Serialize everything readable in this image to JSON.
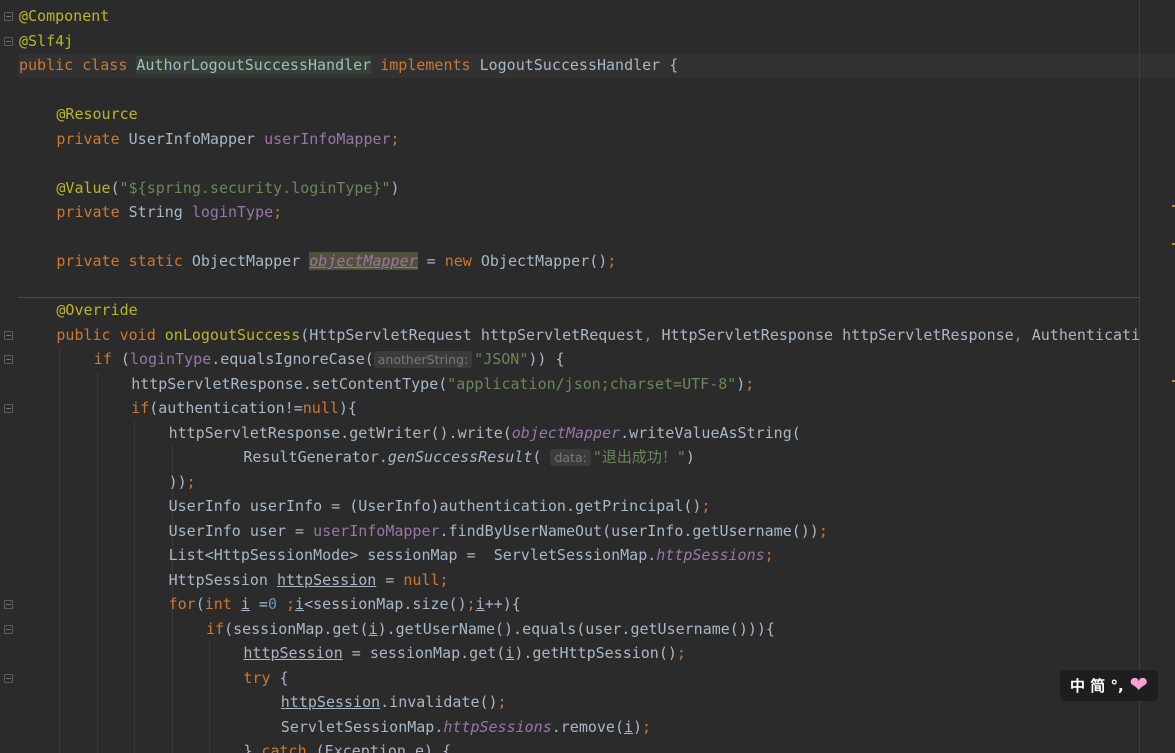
{
  "editor": {
    "language": "java",
    "lines": [
      {
        "indent": 0,
        "fold": true,
        "tokens": [
          {
            "t": "@Component",
            "c": "ann"
          }
        ]
      },
      {
        "indent": 0,
        "fold": true,
        "tokens": [
          {
            "t": "@Slf4j",
            "c": "ann"
          }
        ]
      },
      {
        "indent": 0,
        "fold": false,
        "tokens": [
          {
            "t": "public ",
            "c": "kw"
          },
          {
            "t": "class ",
            "c": "kw"
          },
          {
            "t": "AuthorLogoutSuccessHandler",
            "c": "cls-hl"
          },
          {
            "t": " implements ",
            "c": "kw"
          },
          {
            "t": "LogoutSuccessHandler {",
            "c": ""
          }
        ]
      },
      {
        "indent": 0,
        "fold": false,
        "tokens": []
      },
      {
        "indent": 4,
        "fold": false,
        "tokens": [
          {
            "t": "@Resource",
            "c": "ann"
          }
        ]
      },
      {
        "indent": 4,
        "fold": false,
        "tokens": [
          {
            "t": "private ",
            "c": "kw"
          },
          {
            "t": "UserInfoMapper ",
            "c": ""
          },
          {
            "t": "userInfoMapper",
            "c": "fld"
          },
          {
            "t": ";",
            "c": "kw"
          }
        ]
      },
      {
        "indent": 0,
        "fold": false,
        "tokens": []
      },
      {
        "indent": 4,
        "fold": false,
        "tokens": [
          {
            "t": "@Value",
            "c": "ann"
          },
          {
            "t": "(",
            "c": ""
          },
          {
            "t": "\"${spring.security.loginType}\"",
            "c": "str"
          },
          {
            "t": ")",
            "c": ""
          }
        ]
      },
      {
        "indent": 4,
        "fold": false,
        "tokens": [
          {
            "t": "private ",
            "c": "kw"
          },
          {
            "t": "String ",
            "c": ""
          },
          {
            "t": "loginType",
            "c": "fld"
          },
          {
            "t": ";",
            "c": "kw"
          }
        ]
      },
      {
        "indent": 0,
        "fold": false,
        "tokens": []
      },
      {
        "indent": 4,
        "fold": false,
        "tokens": [
          {
            "t": "private ",
            "c": "kw"
          },
          {
            "t": "static ",
            "c": "kw"
          },
          {
            "t": "ObjectMapper ",
            "c": ""
          },
          {
            "t": "objectMapper",
            "c": "sel"
          },
          {
            "t": " = ",
            "c": ""
          },
          {
            "t": "new ",
            "c": "kw"
          },
          {
            "t": "ObjectMapper()",
            "c": ""
          },
          {
            "t": ";",
            "c": "kw"
          }
        ]
      },
      {
        "indent": 0,
        "fold": false,
        "tokens": []
      },
      {
        "indent": 4,
        "fold": false,
        "tokens": [
          {
            "t": "@Override",
            "c": "ann"
          }
        ]
      },
      {
        "indent": 4,
        "fold": true,
        "tokens": [
          {
            "t": "public ",
            "c": "kw"
          },
          {
            "t": "void ",
            "c": "kw"
          },
          {
            "t": "onLogoutSuccess",
            "c": "ann"
          },
          {
            "t": "(HttpServletRequest httpServletRequest",
            "c": ""
          },
          {
            "t": ", ",
            "c": "kw"
          },
          {
            "t": "HttpServletResponse httpServletResponse",
            "c": ""
          },
          {
            "t": ", ",
            "c": "kw"
          },
          {
            "t": "Authenticati",
            "c": ""
          }
        ]
      },
      {
        "indent": 8,
        "fold": true,
        "tokens": [
          {
            "t": "if ",
            "c": "kw"
          },
          {
            "t": "(",
            "c": ""
          },
          {
            "t": "loginType",
            "c": "fld"
          },
          {
            "t": ".equalsIgnoreCase(",
            "c": ""
          },
          {
            "t": "anotherString:",
            "c": "hint"
          },
          {
            "t": "\"JSON\"",
            "c": "str"
          },
          {
            "t": ")) {",
            "c": ""
          }
        ]
      },
      {
        "indent": 12,
        "fold": false,
        "tokens": [
          {
            "t": "httpServletResponse.setContentType(",
            "c": ""
          },
          {
            "t": "\"application/json;charset=UTF-8\"",
            "c": "str"
          },
          {
            "t": ")",
            "c": ""
          },
          {
            "t": ";",
            "c": "kw"
          }
        ]
      },
      {
        "indent": 12,
        "fold": true,
        "tokens": [
          {
            "t": "if",
            "c": "kw"
          },
          {
            "t": "(authentication!=",
            "c": ""
          },
          {
            "t": "null",
            "c": "kw"
          },
          {
            "t": "){",
            "c": ""
          }
        ]
      },
      {
        "indent": 16,
        "fold": false,
        "tokens": [
          {
            "t": "httpServletResponse.getWriter().write(",
            "c": ""
          },
          {
            "t": "objectMapper",
            "c": "sfld"
          },
          {
            "t": ".writeValueAsString(",
            "c": ""
          }
        ]
      },
      {
        "indent": 24,
        "fold": false,
        "tokens": [
          {
            "t": "ResultGenerator.",
            "c": ""
          },
          {
            "t": "genSuccessResult",
            "c": "smeth"
          },
          {
            "t": "( ",
            "c": ""
          },
          {
            "t": "data:",
            "c": "hint"
          },
          {
            "t": "\"退出成功！\"",
            "c": "str"
          },
          {
            "t": ")",
            "c": ""
          }
        ]
      },
      {
        "indent": 16,
        "fold": false,
        "tokens": [
          {
            "t": "))",
            "c": ""
          },
          {
            "t": ";",
            "c": "kw"
          }
        ]
      },
      {
        "indent": 16,
        "fold": false,
        "tokens": [
          {
            "t": "UserInfo userInfo = (UserInfo)authentication.getPrincipal()",
            "c": ""
          },
          {
            "t": ";",
            "c": "kw"
          }
        ]
      },
      {
        "indent": 16,
        "fold": false,
        "tokens": [
          {
            "t": "UserInfo user = ",
            "c": ""
          },
          {
            "t": "userInfoMapper",
            "c": "fld"
          },
          {
            "t": ".findByUserNameOut(userInfo.getUsername())",
            "c": ""
          },
          {
            "t": ";",
            "c": "kw"
          }
        ]
      },
      {
        "indent": 16,
        "fold": false,
        "tokens": [
          {
            "t": "List<HttpSessionMode> sessionMap =  ServletSessionMap.",
            "c": ""
          },
          {
            "t": "httpSessions",
            "c": "sfld"
          },
          {
            "t": ";",
            "c": "kw"
          }
        ]
      },
      {
        "indent": 16,
        "fold": false,
        "tokens": [
          {
            "t": "HttpSession ",
            "c": ""
          },
          {
            "t": "httpSession",
            "c": "ul"
          },
          {
            "t": " = ",
            "c": ""
          },
          {
            "t": "null",
            "c": "kw"
          },
          {
            "t": ";",
            "c": "kw"
          }
        ]
      },
      {
        "indent": 16,
        "fold": true,
        "tokens": [
          {
            "t": "for",
            "c": "kw"
          },
          {
            "t": "(",
            "c": ""
          },
          {
            "t": "int ",
            "c": "kw"
          },
          {
            "t": "i",
            "c": "ul"
          },
          {
            "t": " =",
            "c": ""
          },
          {
            "t": "0",
            "c": "num"
          },
          {
            "t": " ;",
            "c": "kw"
          },
          {
            "t": "i",
            "c": "ul"
          },
          {
            "t": "<sessionMap.size()",
            "c": ""
          },
          {
            "t": ";",
            "c": "kw"
          },
          {
            "t": "i",
            "c": "ul"
          },
          {
            "t": "++){",
            "c": ""
          }
        ]
      },
      {
        "indent": 20,
        "fold": true,
        "tokens": [
          {
            "t": "if",
            "c": "kw"
          },
          {
            "t": "(sessionMap.get(",
            "c": ""
          },
          {
            "t": "i",
            "c": "ul"
          },
          {
            "t": ").getUserName().equals(user.getUsername())){",
            "c": ""
          }
        ]
      },
      {
        "indent": 24,
        "fold": false,
        "tokens": [
          {
            "t": "httpSession",
            "c": "ul"
          },
          {
            "t": " = sessionMap.get(",
            "c": ""
          },
          {
            "t": "i",
            "c": "ul"
          },
          {
            "t": ").getHttpSession()",
            "c": ""
          },
          {
            "t": ";",
            "c": "kw"
          }
        ]
      },
      {
        "indent": 24,
        "fold": true,
        "tokens": [
          {
            "t": "try ",
            "c": "kw"
          },
          {
            "t": "{",
            "c": ""
          }
        ]
      },
      {
        "indent": 28,
        "fold": false,
        "tokens": [
          {
            "t": "httpSession",
            "c": "ul"
          },
          {
            "t": ".invalidate()",
            "c": ""
          },
          {
            "t": ";",
            "c": "kw"
          }
        ]
      },
      {
        "indent": 28,
        "fold": false,
        "tokens": [
          {
            "t": "ServletSessionMap.",
            "c": ""
          },
          {
            "t": "httpSessions",
            "c": "sfld"
          },
          {
            "t": ".remove(",
            "c": ""
          },
          {
            "t": "i",
            "c": "ul"
          },
          {
            "t": ")",
            "c": ""
          },
          {
            "t": ";",
            "c": "kw"
          }
        ]
      },
      {
        "indent": 24,
        "fold": false,
        "tokens": [
          {
            "t": "} ",
            "c": ""
          },
          {
            "t": "catch ",
            "c": "kw"
          },
          {
            "t": "(Exception e) {",
            "c": ""
          }
        ]
      }
    ]
  },
  "ime": {
    "label": "中 简 °,",
    "heart_icon": "heart-icon"
  },
  "colors": {
    "background": "#2b2b2b",
    "keyword": "#cc7832",
    "annotation": "#bbb529",
    "field": "#9876aa",
    "string": "#6a8759",
    "number": "#6897bb",
    "text": "#a9b7c6"
  }
}
